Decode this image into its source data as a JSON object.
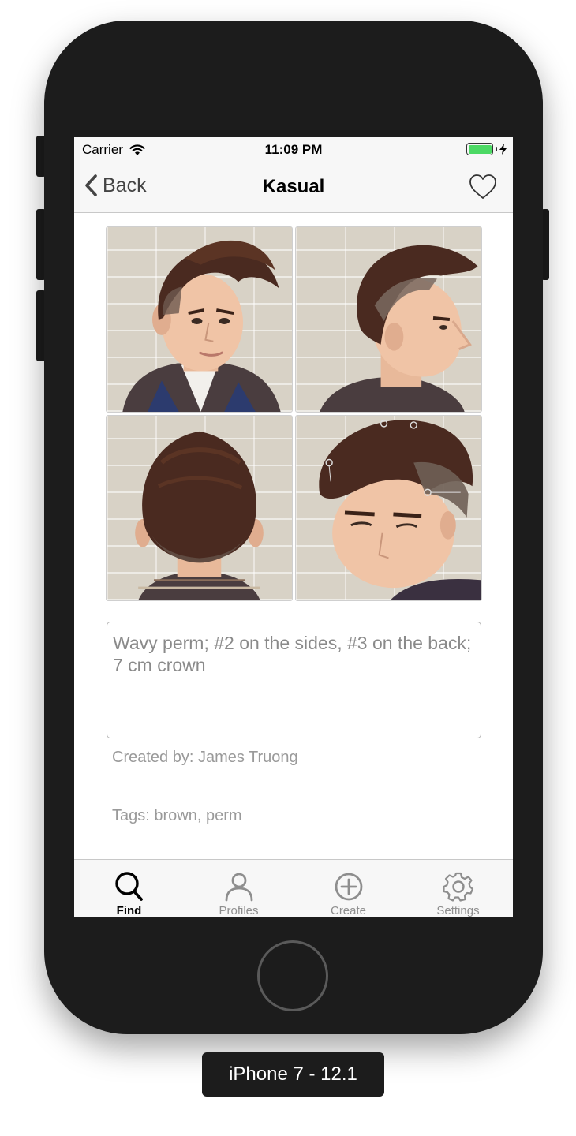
{
  "status_bar": {
    "carrier": "Carrier",
    "time": "11:09 PM",
    "battery_level": 1.0,
    "battery_color": "#4cd964"
  },
  "nav": {
    "back_label": "Back",
    "title": "Kasual",
    "favorite_icon": "heart-outline-icon"
  },
  "photos": [
    {
      "view": "front"
    },
    {
      "view": "side"
    },
    {
      "view": "back"
    },
    {
      "view": "top"
    }
  ],
  "description": "Wavy perm; #2 on the sides, #3 on the back; 7 cm crown",
  "created_by": "Created by: James Truong",
  "tags": "Tags: brown, perm",
  "tab_bar": {
    "items": [
      {
        "label": "Find",
        "icon": "search-icon",
        "active": true
      },
      {
        "label": "Profiles",
        "icon": "person-icon",
        "active": false
      },
      {
        "label": "Create",
        "icon": "plus-circle-icon",
        "active": false
      },
      {
        "label": "Settings",
        "icon": "gear-icon",
        "active": false
      }
    ]
  },
  "device_label": "iPhone 7 - 12.1"
}
